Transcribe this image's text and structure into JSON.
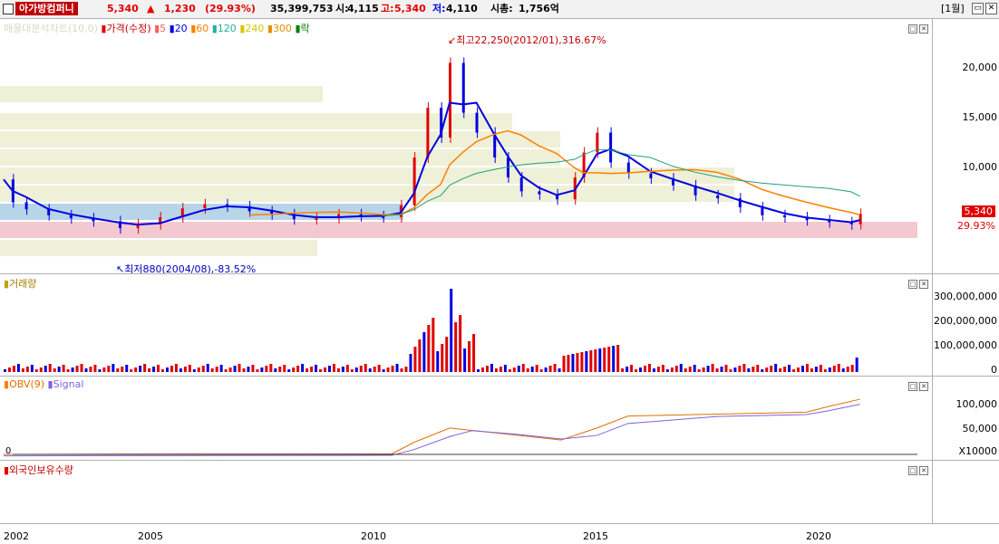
{
  "header": {
    "stock_name": "아가방컴퍼니",
    "price": "5,340",
    "arrow": "▲",
    "change": "1,230",
    "change_pct": "(29.93%)",
    "volume": "35,399,753",
    "open_label": "시:",
    "open_value": "4,115",
    "high_label": "고:",
    "high_value": "5,340",
    "low_label": "저:",
    "low_value": "4,110",
    "cap_label": "시총:",
    "cap_value": "1,756억",
    "period": "[1월]"
  },
  "colors": {
    "up": "#e00000",
    "down": "#0000e0",
    "ma5": "#ff0000",
    "ma20": "#0000ff",
    "ma60": "#ff8000",
    "ma120": "#00a080",
    "ma240": "#d0c000",
    "ma300": "#e08000"
  },
  "price_panel": {
    "legend": {
      "title": "매물대분석차트(10,0)",
      "price_label": "가격(수정)",
      "ma5": "5",
      "ma20": "20",
      "ma60": "60",
      "ma120": "120",
      "ma240": "240",
      "ma300": "300",
      "extra": "락"
    },
    "y_ticks": [
      "20,000",
      "15,000",
      "10,000"
    ],
    "current_price_tag": "5,340",
    "current_pct_tag": "29.93%",
    "high_annotation": "최고22,250(2012/01),316.67%",
    "low_annotation": "최저880(2004/08),-83.52%"
  },
  "volume_panel": {
    "legend": "거래량",
    "y_ticks": [
      "300,000,000",
      "200,000,000",
      "100,000,000",
      "0"
    ]
  },
  "obv_panel": {
    "legend_obv": "OBV(9)",
    "legend_signal": "Signal",
    "y_ticks": [
      "100,000",
      "50,000",
      "X10000"
    ],
    "zero_label": "0"
  },
  "foreign_panel": {
    "legend": "외국인보유수량"
  },
  "x_axis": {
    "labels": [
      "2002",
      "2005",
      "2010",
      "2015",
      "2020"
    ]
  }
}
